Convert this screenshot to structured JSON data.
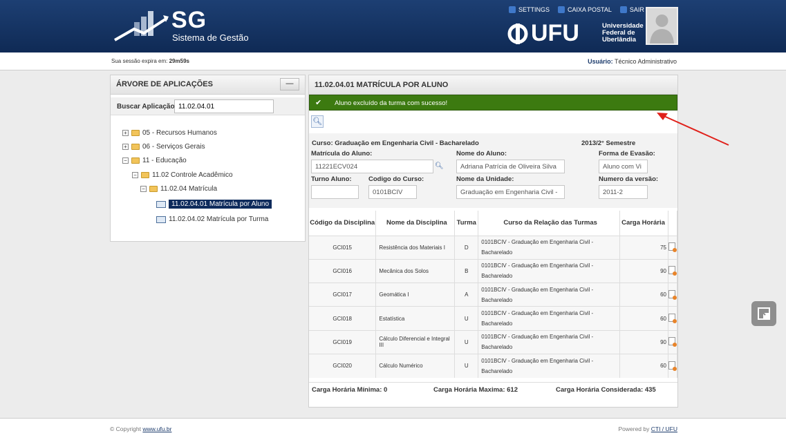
{
  "header": {
    "logo_title": "SG",
    "logo_subtitle": "Sistema de Gestão",
    "nav": [
      "SETTINGS",
      "CAIXA POSTAL",
      "SAIR"
    ],
    "university_logo": "UFU",
    "university_name": [
      "Universidade",
      "Federal de",
      "Uberlândia"
    ]
  },
  "infobar": {
    "session_label": "Sua sessão expira em:",
    "session_time": "29m59s",
    "user_label": "Usuário:",
    "user_value": "Técnico Administrativo"
  },
  "left_panel": {
    "title": "ÁRVORE DE APLICAÇÕES",
    "collapse_label": "—",
    "search_label": "Buscar Aplicação",
    "search_value": "11.02.04.01",
    "tree": [
      "05 - Recursos Humanos",
      "06 - Serviços Gerais",
      "11 - Educação",
      "11.02 Controle Acadêmico",
      "11.02.04 Matrícula",
      "11.02.04.01 Matrícula por Aluno",
      "11.02.04.02 Matrícula por Turma"
    ]
  },
  "right_panel": {
    "title": "11.02.04.01 MATRÍCULA POR ALUNO",
    "success_message": "Aluno excluído da turma com sucesso!",
    "curso_line": "Curso: Graduação em Engenharia Civil - Bacharelado",
    "semestre": "2013/2° Semestre",
    "labels": {
      "matricula": "Matrícula do Aluno:",
      "nome_aluno": "Nome do Aluno:",
      "forma_evasao": "Forma de Evasão:",
      "turno": "Turno Aluno:",
      "codigo_curso": "Codigo do Curso:",
      "nome_unidade": "Nome da Unidade:",
      "numero_versao": "Numero da versão:"
    },
    "values": {
      "matricula": "11221ECV024",
      "nome_aluno": "Adriana Patrícia de Oliveira Silva",
      "forma_evasao": "Aluno com Vi",
      "turno": "",
      "codigo_curso": "0101BCIV",
      "nome_unidade": "Graduação em Engenharia Civil -",
      "numero_versao": "2011-2"
    },
    "table": {
      "headers": [
        "Código da Disciplina",
        "Nome da Disciplina",
        "Turma",
        "Curso da Relação das Turmas",
        "Carga Horária"
      ],
      "rows": [
        {
          "codigo": "GCI015",
          "nome": "Resistência dos Materiais I",
          "turma": "D",
          "curso": "0101BCIV - Graduação em Engenharia Civil - Bacharelado",
          "carga": "75"
        },
        {
          "codigo": "GCI016",
          "nome": "Mecânica dos Solos",
          "turma": "B",
          "curso": "0101BCIV - Graduação em Engenharia Civil - Bacharelado",
          "carga": "90"
        },
        {
          "codigo": "GCI017",
          "nome": "Geomática I",
          "turma": "A",
          "curso": "0101BCIV - Graduação em Engenharia Civil - Bacharelado",
          "carga": "60"
        },
        {
          "codigo": "GCI018",
          "nome": "Estatística",
          "turma": "U",
          "curso": "0101BCIV - Graduação em Engenharia Civil - Bacharelado",
          "carga": "60"
        },
        {
          "codigo": "GCI019",
          "nome": "Cálculo Diferencial e Integral III",
          "turma": "U",
          "curso": "0101BCIV - Graduação em Engenharia Civil - Bacharelado",
          "carga": "90"
        },
        {
          "codigo": "GCI020",
          "nome": "Cálculo Numérico",
          "turma": "U",
          "curso": "0101BCIV - Graduação em Engenharia Civil - Bacharelado",
          "carga": "60"
        }
      ]
    },
    "stats": {
      "min": "Carga Horária Mínima: 0",
      "max": "Carga Horária Maxima: 612",
      "considerada": "Carga Horária Considerada: 435"
    }
  },
  "footer": {
    "copyright_prefix": "© Copyright",
    "copyright_link": "www.ufu.br",
    "powered_prefix": "Powered by",
    "powered_link": "CTI / UFU"
  },
  "colors": {
    "header_bg": "#1d3f73",
    "success_bg": "#3c7a10",
    "selected_bg": "#0e2b5c",
    "annotation_arrow": "#e0201a"
  }
}
